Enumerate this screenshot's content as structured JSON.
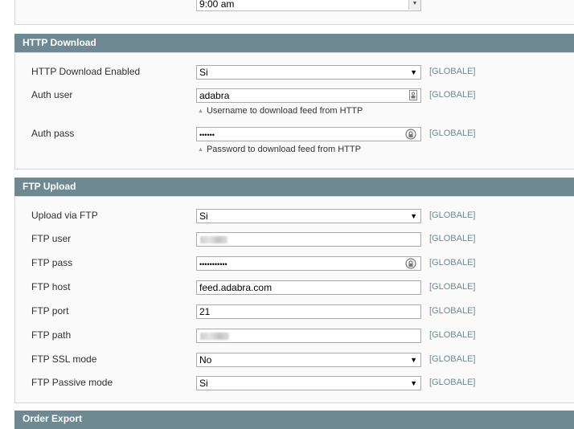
{
  "top_time": {
    "value": "9:00 am"
  },
  "http_download": {
    "title": "HTTP Download",
    "enabled": {
      "label": "HTTP Download Enabled",
      "value": "Si",
      "scope": "[GLOBALE]"
    },
    "auth_user": {
      "label": "Auth user",
      "value": "adabra",
      "scope": "[GLOBALE]",
      "hint": "Username to download feed from HTTP"
    },
    "auth_pass": {
      "label": "Auth pass",
      "value": "••••••",
      "scope": "[GLOBALE]",
      "hint": "Password to download feed from HTTP"
    }
  },
  "ftp_upload": {
    "title": "FTP Upload",
    "via_ftp": {
      "label": "Upload via FTP",
      "value": "Si",
      "scope": "[GLOBALE]"
    },
    "ftp_user": {
      "label": "FTP user",
      "scope": "[GLOBALE]"
    },
    "ftp_pass": {
      "label": "FTP pass",
      "value": "•••••••••••",
      "scope": "[GLOBALE]"
    },
    "ftp_host": {
      "label": "FTP host",
      "value": "feed.adabra.com",
      "scope": "[GLOBALE]"
    },
    "ftp_port": {
      "label": "FTP port",
      "value": "21",
      "scope": "[GLOBALE]"
    },
    "ftp_path": {
      "label": "FTP path",
      "scope": "[GLOBALE]"
    },
    "ssl_mode": {
      "label": "FTP SSL mode",
      "value": "No",
      "scope": "[GLOBALE]"
    },
    "passive_mode": {
      "label": "FTP Passive mode",
      "value": "Si",
      "scope": "[GLOBALE]"
    }
  },
  "order_export": {
    "title": "Order Export"
  },
  "icons": {
    "dropdown": "triangle-down",
    "key": "key-icon",
    "password": "lock-icon",
    "hint": "triangle-up"
  }
}
